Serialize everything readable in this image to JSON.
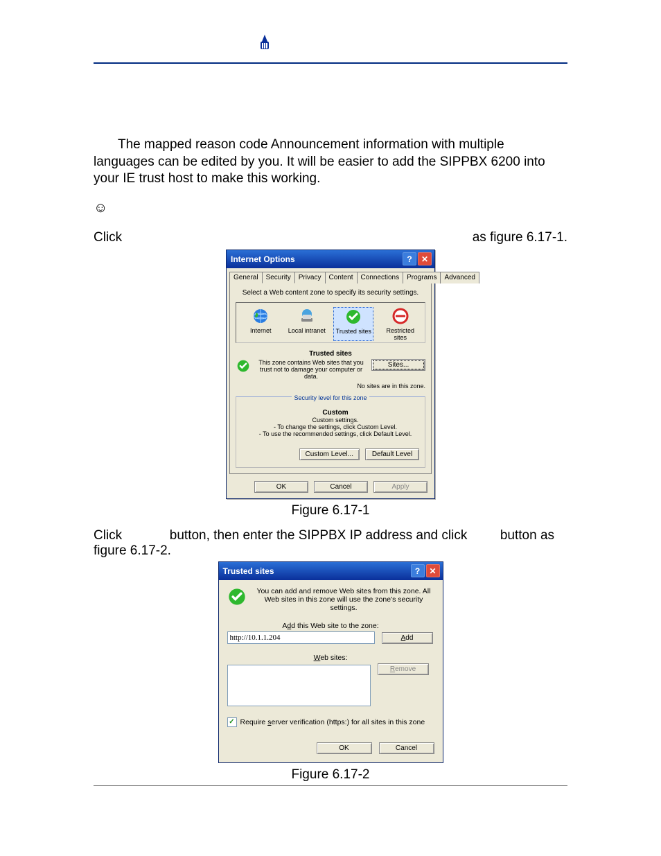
{
  "body": {
    "para1": "The mapped reason code Announcement information with multiple languages can be edited by you. It will be easier to add the SIPPBX 6200 into your IE trust host to make this working.",
    "line_click": "Click",
    "line_asfig1": "as figure 6.17-1.",
    "para2_a": "Click",
    "para2_b": "button, then enter the SIPPBX IP address and click",
    "para2_c": "button as",
    "para2_d": "figure 6.17-2."
  },
  "captions": {
    "fig1": "Figure 6.17-1",
    "fig2": "Figure 6.17-2"
  },
  "internetOptions": {
    "title": "Internet Options",
    "tabs": [
      "General",
      "Security",
      "Privacy",
      "Content",
      "Connections",
      "Programs",
      "Advanced"
    ],
    "activeTabIndex": 1,
    "selectZoneInstr": "Select a Web content zone to specify its security settings.",
    "zones": [
      {
        "label": "Internet",
        "icon": "globe"
      },
      {
        "label": "Local intranet",
        "icon": "intranet"
      },
      {
        "label": "Trusted sites",
        "icon": "trusted"
      },
      {
        "label": "Restricted sites",
        "icon": "restricted"
      }
    ],
    "selectedZoneIndex": 2,
    "zoneGroupTitle": "Trusted sites",
    "zoneDesc": "This zone contains Web sites that you trust not to damage your computer or data.",
    "sitesBtn": "Sites...",
    "noSites": "No sites are in this zone.",
    "secLegend": "Security level for this zone",
    "customTitle": "Custom",
    "customLine1": "Custom settings.",
    "customLine2": "- To change the settings, click Custom Level.",
    "customLine3": "- To use the recommended settings, click Default Level.",
    "customLevelBtn": "Custom Level...",
    "defaultLevelBtn": "Default Level",
    "ok": "OK",
    "cancel": "Cancel",
    "apply": "Apply"
  },
  "trustedSites": {
    "title": "Trusted sites",
    "desc": "You can add and remove Web sites from this zone. All Web sites in this zone will use the zone's security settings.",
    "addLabel_pre": "A",
    "addLabel_u": "d",
    "addLabel_post": "d this Web site to the zone:",
    "inputValue": "http://10.1.1.204",
    "addBtn_pre": "",
    "addBtn_u": "A",
    "addBtn_post": "dd",
    "webSitesLabel_u": "W",
    "webSitesLabel_post": "eb sites:",
    "removeBtn_u": "R",
    "removeBtn_post": "emove",
    "requireLabel_pre": "Require ",
    "requireLabel_u": "s",
    "requireLabel_post": "erver verification (https:) for all sites in this zone",
    "requireChecked": true,
    "ok": "OK",
    "cancel": "Cancel"
  }
}
